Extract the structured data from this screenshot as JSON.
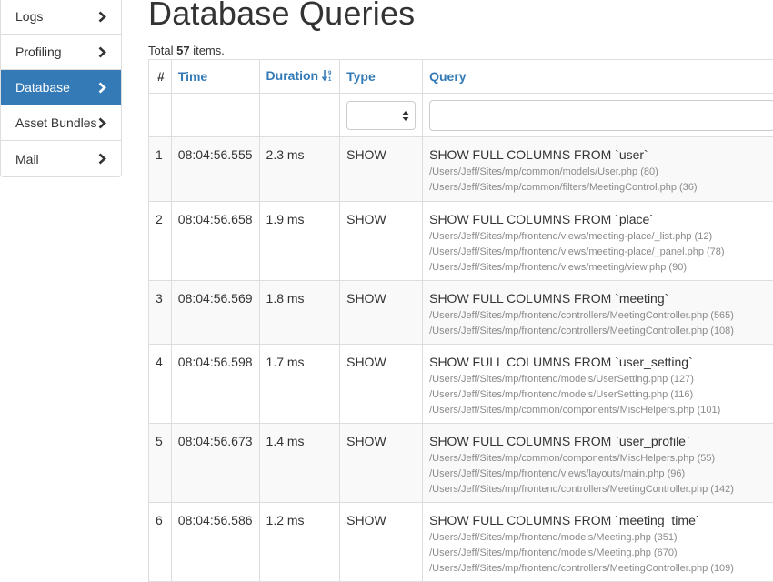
{
  "sidebar": {
    "items": [
      {
        "label": "Logs",
        "active": false
      },
      {
        "label": "Profiling",
        "active": false
      },
      {
        "label": "Database",
        "active": true
      },
      {
        "label": "Asset Bundles",
        "active": false
      },
      {
        "label": "Mail",
        "active": false
      }
    ]
  },
  "page": {
    "title": "Database Queries",
    "summary_prefix": "Total",
    "summary_count": "57",
    "summary_suffix": "items."
  },
  "table": {
    "headers": {
      "index": "#",
      "time": "Time",
      "duration": "Duration",
      "type": "Type",
      "query": "Query"
    },
    "type_filter_value": "",
    "query_filter_value": "",
    "rows": [
      {
        "index": "1",
        "time": "08:04:56.555",
        "duration": "2.3 ms",
        "type": "SHOW",
        "query": "SHOW FULL COLUMNS FROM `user`",
        "trace": [
          "/Users/Jeff/Sites/mp/common/models/User.php (80)",
          "/Users/Jeff/Sites/mp/common/filters/MeetingControl.php (36)"
        ]
      },
      {
        "index": "2",
        "time": "08:04:56.658",
        "duration": "1.9 ms",
        "type": "SHOW",
        "query": "SHOW FULL COLUMNS FROM `place`",
        "trace": [
          "/Users/Jeff/Sites/mp/frontend/views/meeting-place/_list.php (12)",
          "/Users/Jeff/Sites/mp/frontend/views/meeting-place/_panel.php (78)",
          "/Users/Jeff/Sites/mp/frontend/views/meeting/view.php (90)"
        ]
      },
      {
        "index": "3",
        "time": "08:04:56.569",
        "duration": "1.8 ms",
        "type": "SHOW",
        "query": "SHOW FULL COLUMNS FROM `meeting`",
        "trace": [
          "/Users/Jeff/Sites/mp/frontend/controllers/MeetingController.php (565)",
          "/Users/Jeff/Sites/mp/frontend/controllers/MeetingController.php (108)"
        ]
      },
      {
        "index": "4",
        "time": "08:04:56.598",
        "duration": "1.7 ms",
        "type": "SHOW",
        "query": "SHOW FULL COLUMNS FROM `user_setting`",
        "trace": [
          "/Users/Jeff/Sites/mp/frontend/models/UserSetting.php (127)",
          "/Users/Jeff/Sites/mp/frontend/models/UserSetting.php (116)",
          "/Users/Jeff/Sites/mp/common/components/MiscHelpers.php (101)"
        ]
      },
      {
        "index": "5",
        "time": "08:04:56.673",
        "duration": "1.4 ms",
        "type": "SHOW",
        "query": "SHOW FULL COLUMNS FROM `user_profile`",
        "trace": [
          "/Users/Jeff/Sites/mp/common/components/MiscHelpers.php (55)",
          "/Users/Jeff/Sites/mp/frontend/views/layouts/main.php (96)",
          "/Users/Jeff/Sites/mp/frontend/controllers/MeetingController.php (142)"
        ]
      },
      {
        "index": "6",
        "time": "08:04:56.586",
        "duration": "1.2 ms",
        "type": "SHOW",
        "query": "SHOW FULL COLUMNS FROM `meeting_time`",
        "trace": [
          "/Users/Jeff/Sites/mp/frontend/models/Meeting.php (351)",
          "/Users/Jeff/Sites/mp/frontend/models/Meeting.php (670)",
          "/Users/Jeff/Sites/mp/frontend/controllers/MeetingController.php (109)"
        ]
      }
    ]
  },
  "colors": {
    "accent": "#337ab7",
    "border": "#dddddd",
    "stripe": "#f9f9f9",
    "trace_text": "#8a8a8a"
  },
  "icons": {
    "sidebar_item": "chevron-right-icon",
    "duration_sort": "sort-numeric-desc-icon",
    "type_select": "select-arrows-icon"
  }
}
